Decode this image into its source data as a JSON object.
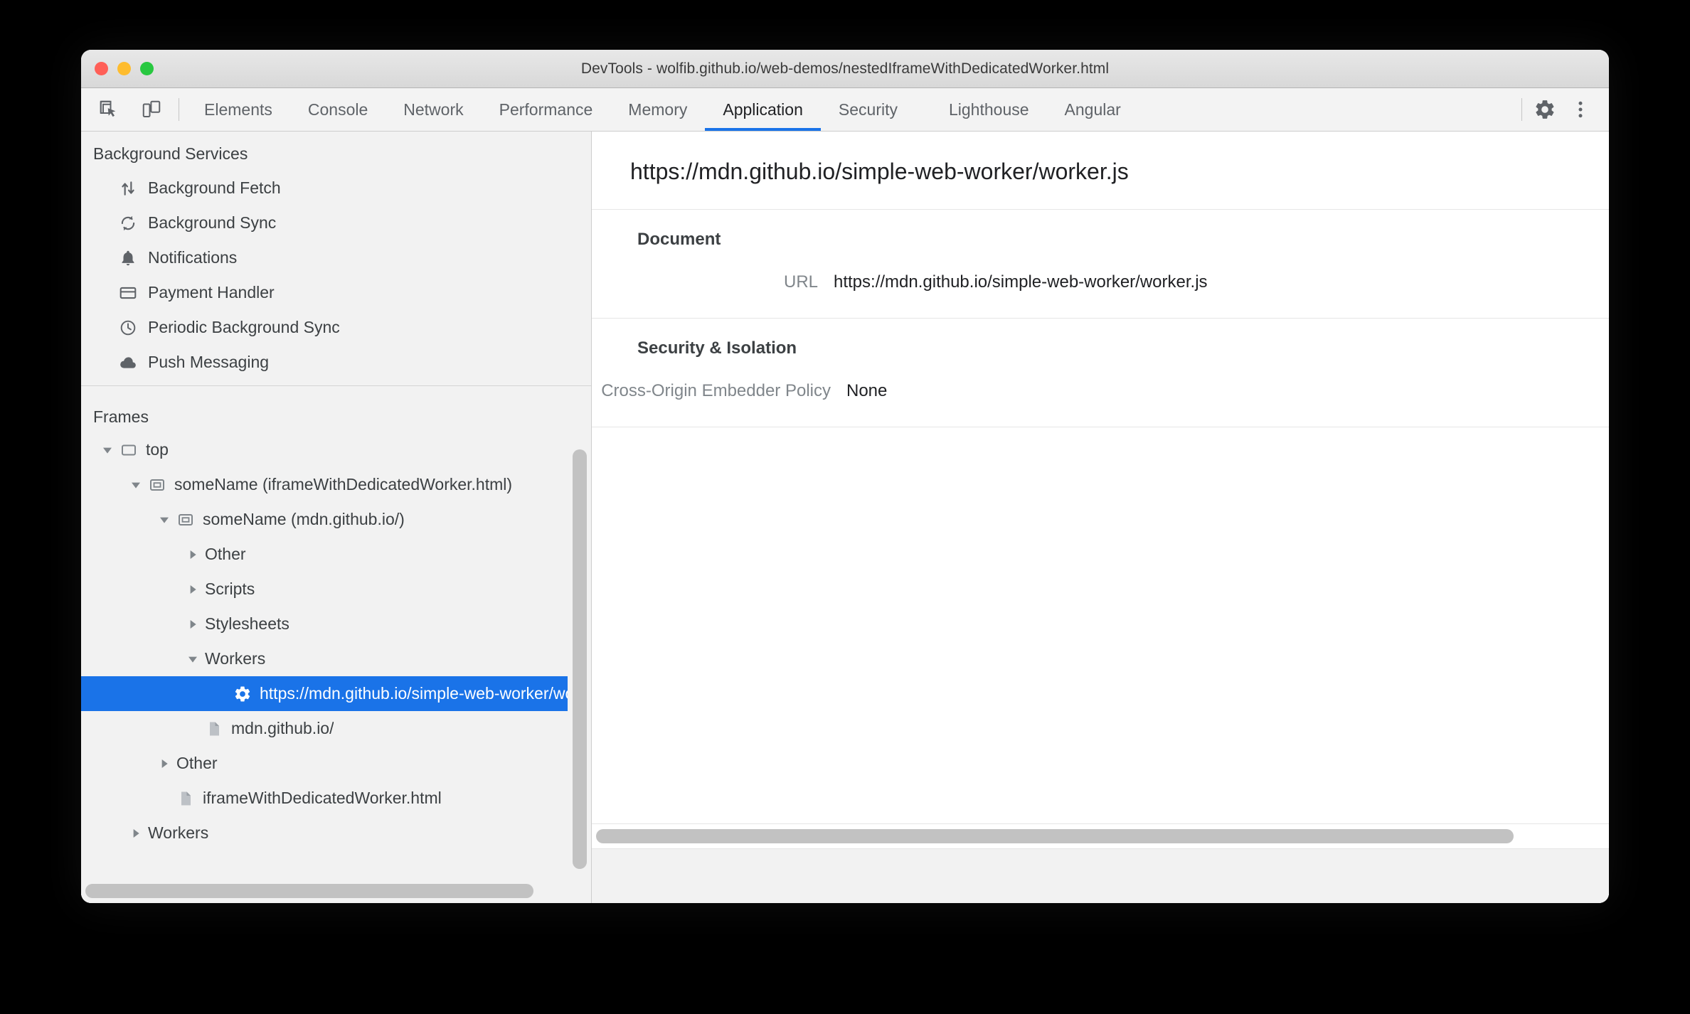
{
  "window": {
    "title": "DevTools - wolfib.github.io/web-demos/nestedIframeWithDedicatedWorker.html",
    "traffic_lights": [
      "close-button",
      "minimize-button",
      "zoom-button"
    ]
  },
  "toolbar": {
    "inspect_icon": "inspect-element-icon",
    "device_icon": "device-toolbar-icon",
    "settings_icon": "gear-icon",
    "more_icon": "kebab-menu-icon",
    "tabs": [
      {
        "label": "Elements",
        "active": false
      },
      {
        "label": "Console",
        "active": false
      },
      {
        "label": "Network",
        "active": false
      },
      {
        "label": "Performance",
        "active": false
      },
      {
        "label": "Memory",
        "active": false
      },
      {
        "label": "Application",
        "active": true
      },
      {
        "label": "Security",
        "active": false
      },
      {
        "label": "Lighthouse",
        "active": false
      },
      {
        "label": "Angular",
        "active": false
      }
    ],
    "active_tab": "Application",
    "accent_color": "#1a73e8"
  },
  "sidebar": {
    "background_services": {
      "title": "Background Services",
      "items": [
        {
          "label": "Background Fetch",
          "icon": "background-fetch-icon"
        },
        {
          "label": "Background Sync",
          "icon": "background-sync-icon"
        },
        {
          "label": "Notifications",
          "icon": "bell-icon"
        },
        {
          "label": "Payment Handler",
          "icon": "credit-card-icon"
        },
        {
          "label": "Periodic Background Sync",
          "icon": "clock-icon"
        },
        {
          "label": "Push Messaging",
          "icon": "cloud-icon"
        }
      ]
    },
    "frames": {
      "title": "Frames",
      "tree": [
        {
          "label": "top",
          "icon": "frame-icon",
          "twisty": "expanded",
          "indent": 0,
          "selected": false
        },
        {
          "label": "someName (iframeWithDedicatedWorker.html)",
          "icon": "iframe-icon",
          "twisty": "expanded",
          "indent": 1,
          "selected": false
        },
        {
          "label": "someName (mdn.github.io/)",
          "icon": "iframe-icon",
          "twisty": "expanded",
          "indent": 2,
          "selected": false
        },
        {
          "label": "Other",
          "icon": "none",
          "twisty": "collapsed",
          "indent": 3,
          "selected": false
        },
        {
          "label": "Scripts",
          "icon": "none",
          "twisty": "collapsed",
          "indent": 3,
          "selected": false
        },
        {
          "label": "Stylesheets",
          "icon": "none",
          "twisty": "collapsed",
          "indent": 3,
          "selected": false
        },
        {
          "label": "Workers",
          "icon": "none",
          "twisty": "expanded",
          "indent": 3,
          "selected": false
        },
        {
          "label": "https://mdn.github.io/simple-web-worker/worker.js",
          "icon": "gear-icon",
          "twisty": "none",
          "indent": 4,
          "selected": true
        },
        {
          "label": "mdn.github.io/",
          "icon": "document-icon",
          "twisty": "none",
          "indent": 3,
          "selected": false
        },
        {
          "label": "Other",
          "icon": "none",
          "twisty": "collapsed",
          "indent": 2,
          "selected": false
        },
        {
          "label": "iframeWithDedicatedWorker.html",
          "icon": "document-icon",
          "twisty": "none",
          "indent": 2,
          "selected": false
        },
        {
          "label": "Workers",
          "icon": "none",
          "twisty": "collapsed",
          "indent": 1,
          "selected": false
        }
      ],
      "selection_color": "#1a73e8"
    }
  },
  "main": {
    "header": "https://mdn.github.io/simple-web-worker/worker.js",
    "groups": [
      {
        "title": "Document",
        "rows": [
          {
            "key": "URL",
            "value": "https://mdn.github.io/simple-web-worker/worker.js"
          }
        ]
      },
      {
        "title": "Security & Isolation",
        "rows": [
          {
            "key": "Cross-Origin Embedder Policy",
            "value": "None"
          }
        ]
      }
    ]
  }
}
